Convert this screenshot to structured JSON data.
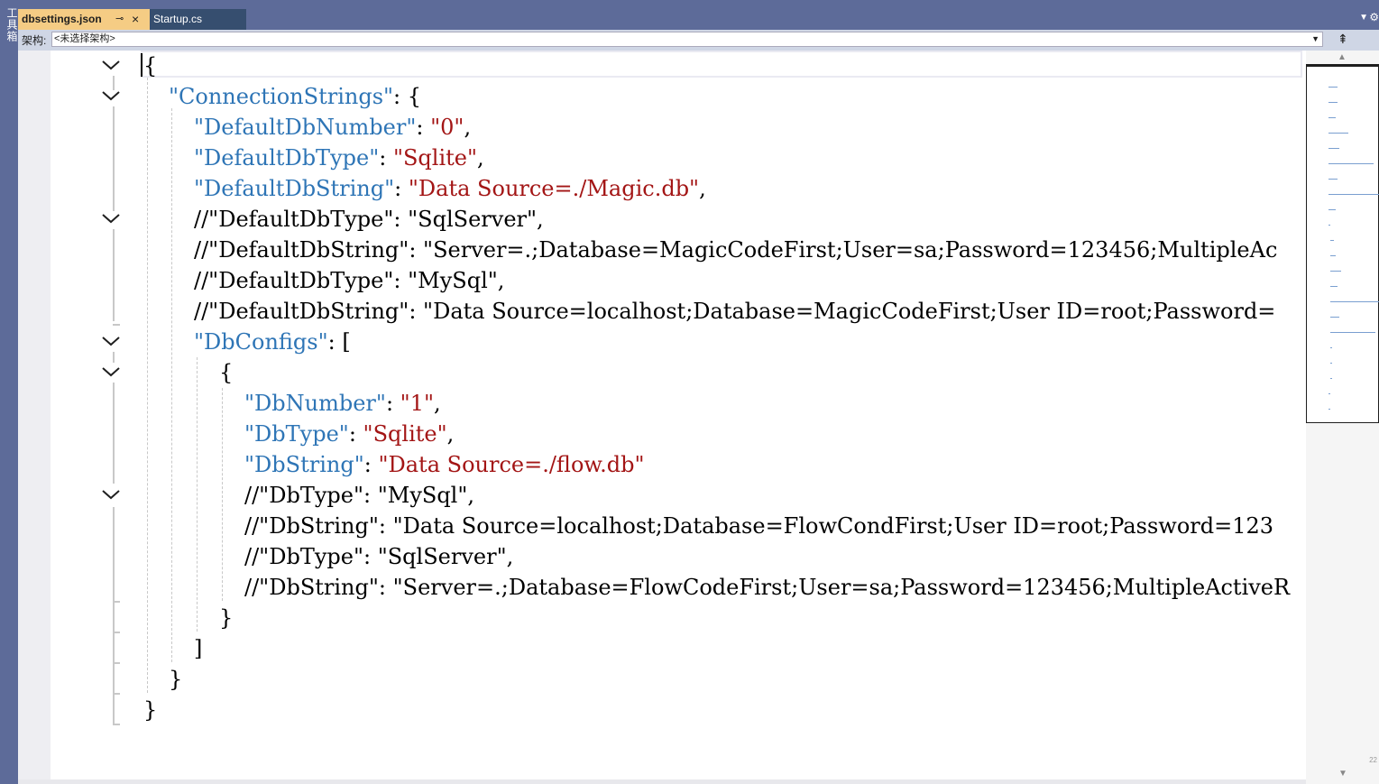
{
  "toolstrip": {
    "label": "工具箱"
  },
  "tabs": [
    {
      "label": "dbsettings.json",
      "active": true
    },
    {
      "label": "Startup.cs",
      "active": false
    }
  ],
  "tab_icons": {
    "pin": "pin-icon",
    "close": "close-icon",
    "overflow": "chevron-down-icon",
    "settings": "gear-icon"
  },
  "navbar": {
    "label": "架构:",
    "combo_value": "<未选择架构>",
    "split_icon": "split-icon"
  },
  "colors": {
    "key": "#2e75b6",
    "string": "#a31515",
    "active_tab": "#f5cc84",
    "chrome": "#5d6b99"
  },
  "code_lines": [
    {
      "indent": "",
      "parts": [
        {
          "t": "{",
          "c": "c"
        }
      ]
    },
    {
      "indent": "  ",
      "parts": [
        {
          "t": "\"ConnectionStrings\"",
          "c": "k"
        },
        {
          "t": ": {",
          "c": "c"
        }
      ]
    },
    {
      "indent": "    ",
      "parts": [
        {
          "t": "\"DefaultDbNumber\"",
          "c": "k"
        },
        {
          "t": ": ",
          "c": "c"
        },
        {
          "t": "\"0\"",
          "c": "s"
        },
        {
          "t": ",",
          "c": "c"
        }
      ]
    },
    {
      "indent": "    ",
      "parts": [
        {
          "t": "\"DefaultDbType\"",
          "c": "k"
        },
        {
          "t": ": ",
          "c": "c"
        },
        {
          "t": "\"Sqlite\"",
          "c": "s"
        },
        {
          "t": ",",
          "c": "c"
        }
      ]
    },
    {
      "indent": "    ",
      "parts": [
        {
          "t": "\"DefaultDbString\"",
          "c": "k"
        },
        {
          "t": ": ",
          "c": "c"
        },
        {
          "t": "\"Data Source=./Magic.db\"",
          "c": "s"
        },
        {
          "t": ",",
          "c": "c"
        }
      ]
    },
    {
      "indent": "    ",
      "parts": [
        {
          "t": "//\"DefaultDbType\": \"SqlServer\",",
          "c": "c"
        }
      ]
    },
    {
      "indent": "    ",
      "parts": [
        {
          "t": "//\"DefaultDbString\": \"Server=.;Database=MagicCodeFirst;User=sa;Password=123456;MultipleAc",
          "c": "c"
        }
      ]
    },
    {
      "indent": "    ",
      "parts": [
        {
          "t": "//\"DefaultDbType\": \"MySql\",",
          "c": "c"
        }
      ]
    },
    {
      "indent": "    ",
      "parts": [
        {
          "t": "//\"DefaultDbString\": \"Data Source=localhost;Database=MagicCodeFirst;User ID=root;Password=",
          "c": "c"
        }
      ]
    },
    {
      "indent": "    ",
      "parts": [
        {
          "t": "\"DbConfigs\"",
          "c": "k"
        },
        {
          "t": ": [",
          "c": "c"
        }
      ]
    },
    {
      "indent": "      ",
      "parts": [
        {
          "t": "{",
          "c": "c"
        }
      ]
    },
    {
      "indent": "        ",
      "parts": [
        {
          "t": "\"DbNumber\"",
          "c": "k"
        },
        {
          "t": ": ",
          "c": "c"
        },
        {
          "t": "\"1\"",
          "c": "s"
        },
        {
          "t": ",",
          "c": "c"
        }
      ]
    },
    {
      "indent": "        ",
      "parts": [
        {
          "t": "\"DbType\"",
          "c": "k"
        },
        {
          "t": ": ",
          "c": "c"
        },
        {
          "t": "\"Sqlite\"",
          "c": "s"
        },
        {
          "t": ",",
          "c": "c"
        }
      ]
    },
    {
      "indent": "        ",
      "parts": [
        {
          "t": "\"DbString\"",
          "c": "k"
        },
        {
          "t": ": ",
          "c": "c"
        },
        {
          "t": "\"Data Source=./flow.db\"",
          "c": "s"
        }
      ]
    },
    {
      "indent": "        ",
      "parts": [
        {
          "t": "//\"DbType\": \"MySql\",",
          "c": "c"
        }
      ]
    },
    {
      "indent": "        ",
      "parts": [
        {
          "t": "//\"DbString\": \"Data Source=localhost;Database=FlowCondFirst;User ID=root;Password=123",
          "c": "c"
        }
      ]
    },
    {
      "indent": "        ",
      "parts": [
        {
          "t": "//\"DbType\": \"SqlServer\",",
          "c": "c"
        }
      ]
    },
    {
      "indent": "        ",
      "parts": [
        {
          "t": "//\"DbString\": \"Server=.;Database=FlowCodeFirst;User=sa;Password=123456;MultipleActiveR",
          "c": "c"
        }
      ]
    },
    {
      "indent": "      ",
      "parts": [
        {
          "t": "}",
          "c": "c"
        }
      ]
    },
    {
      "indent": "    ",
      "parts": [
        {
          "t": "]",
          "c": "c"
        }
      ]
    },
    {
      "indent": "  ",
      "parts": [
        {
          "t": "}",
          "c": "c"
        }
      ]
    },
    {
      "indent": "",
      "parts": [
        {
          "t": "}",
          "c": "c"
        }
      ]
    }
  ],
  "fold_lines": [
    0,
    1,
    5,
    9,
    10,
    14
  ],
  "minimap": {
    "line_number": "22"
  }
}
